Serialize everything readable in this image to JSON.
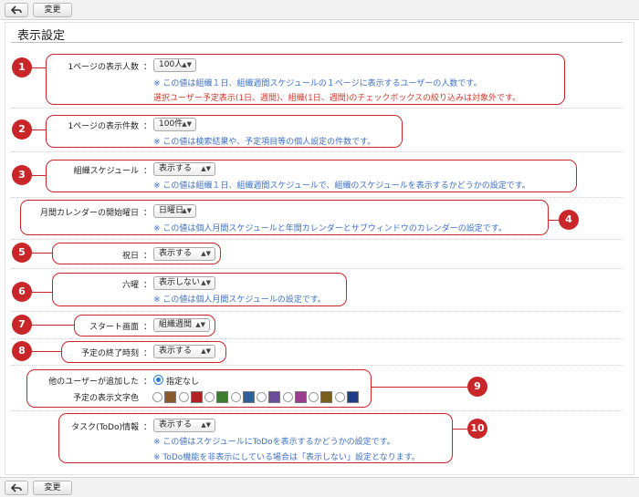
{
  "toolbar": {
    "back_icon": "back-arrow-icon",
    "change_label": "変更"
  },
  "page_title": "表示設定",
  "rows": {
    "members": {
      "label": "1ページの表示人数",
      "value": "100人",
      "note1": "※ この値は組織１日、組織週間スケジュールの１ページに表示するユーザーの人数です。",
      "note2": "選択ユーザー予定表示(1日、週間)、組織(1日、週間)のチェックボックスの絞り込みは対象外です。"
    },
    "items": {
      "label": "1ページの表示件数",
      "value": "100件",
      "note1": "※ この値は検索結果や、予定項目等の個人設定の件数です。"
    },
    "org_schedule": {
      "label": "組織スケジュール",
      "value": "表示する",
      "note1": "※ この値は組織１日、組織週間スケジュールで、組織のスケジュールを表示するかどうかの設定です。"
    },
    "week_start": {
      "label": "月間カレンダーの開始曜日",
      "value": "日曜日",
      "note1": "※ この値は個人月間スケジュールと年間カレンダーとサブウィンドウのカレンダーの設定です。"
    },
    "holiday": {
      "label": "祝日",
      "value": "表示する"
    },
    "rokuyo": {
      "label": "六曜",
      "value": "表示しない",
      "note1": "※ この値は個人月間スケジュールの設定です。"
    },
    "start_screen": {
      "label": "スタート画面",
      "value": "組織週間"
    },
    "end_time": {
      "label": "予定の終了時刻",
      "value": "表示する"
    },
    "other_user_color": {
      "label_line1": "他のユーザーが追加した",
      "label_line2": "予定の表示文字色",
      "option_none": "指定なし",
      "swatches": [
        "#8b5a2b",
        "#b22222",
        "#3a7d2c",
        "#2d5f9e",
        "#6a4b9c",
        "#9b3b8e",
        "#7a5c1e",
        "#1f3a8a"
      ]
    },
    "todo": {
      "label": "タスク(ToDo)情報",
      "value": "表示する",
      "note1": "※ この値はスケジュールにToDoを表示するかどうかの設定です。",
      "note2": "※ ToDo機能を非表示にしている場合は「表示しない」設定となります。"
    }
  },
  "colon": "：",
  "badges": [
    "1",
    "2",
    "3",
    "4",
    "5",
    "6",
    "7",
    "8",
    "9",
    "10"
  ],
  "accent_color": "#c9262a",
  "note_color": "#3c6fc7"
}
